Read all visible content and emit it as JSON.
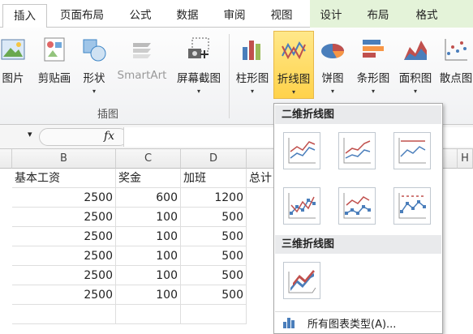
{
  "tabs": [
    "插入",
    "页面布局",
    "公式",
    "数据",
    "审阅",
    "视图",
    "设计",
    "布局",
    "格式"
  ],
  "ribbon": {
    "buttons": [
      "图片",
      "剪贴画",
      "形状",
      "SmartArt",
      "屏幕截图",
      "柱形图",
      "折线图",
      "饼图",
      "条形图",
      "面积图",
      "散点图"
    ],
    "group_label": "插图",
    "dropdown_glyph": "▾"
  },
  "formula_bar": {
    "fx": "fx",
    "name_box_arrow": "▾"
  },
  "columns": [
    "B",
    "C",
    "D",
    "",
    "H"
  ],
  "rows": [
    [
      "基本工资",
      "奖金",
      "加班",
      "总计"
    ],
    [
      "2500",
      "600",
      "1200"
    ],
    [
      "2500",
      "100",
      "500"
    ],
    [
      "2500",
      "100",
      "500"
    ],
    [
      "2500",
      "100",
      "500"
    ],
    [
      "2500",
      "100",
      "500"
    ],
    [
      "2500",
      "100",
      "500"
    ]
  ],
  "menu": {
    "section_2d": "二维折线图",
    "section_3d": "三维折线图",
    "all_types": "所有图表类型(A)..."
  },
  "colors": {
    "accent": "#ffd24a",
    "context_tab": "#e4f3d9"
  }
}
